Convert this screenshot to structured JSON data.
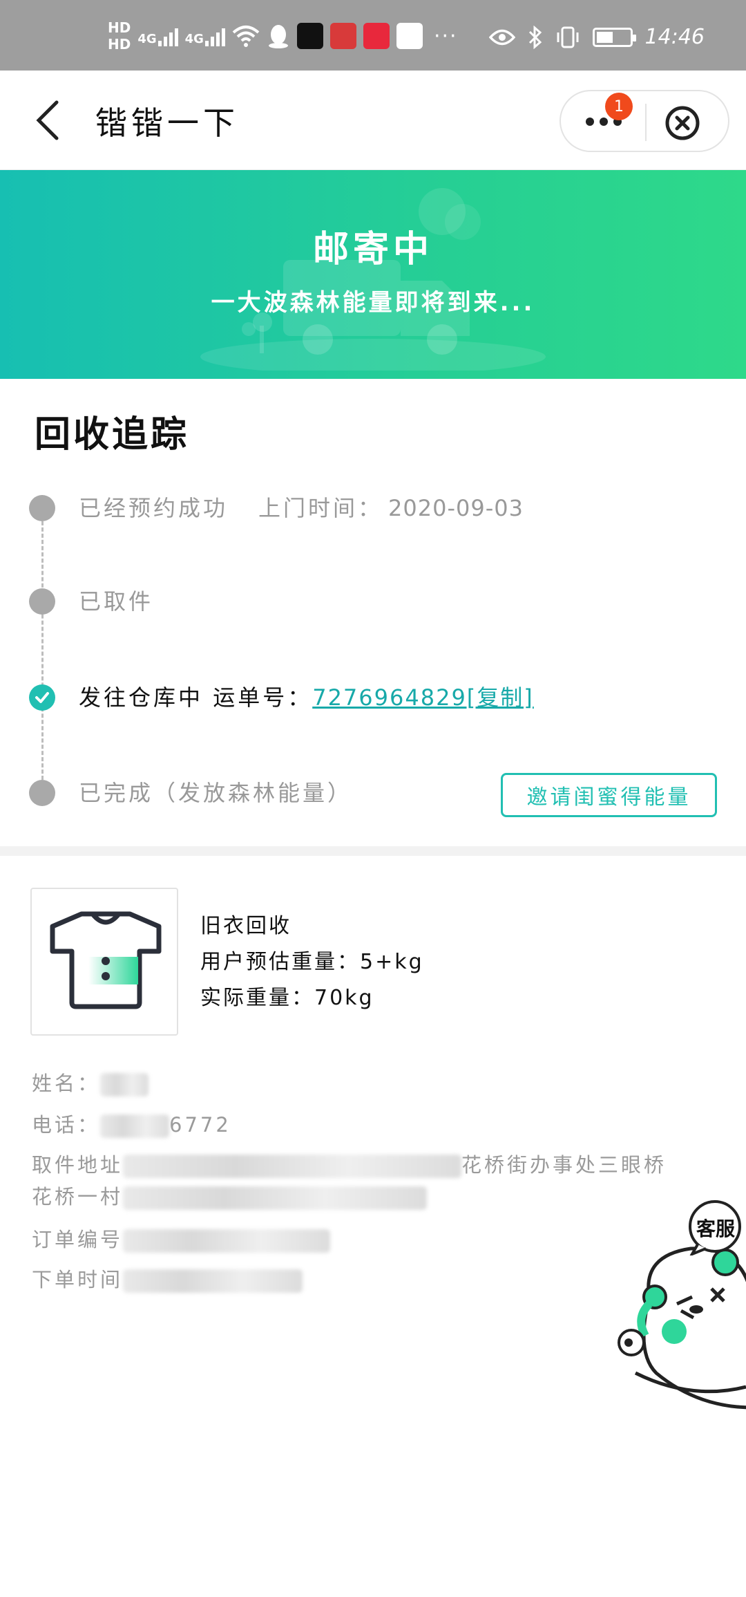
{
  "status_bar": {
    "hd1": "HD",
    "hd2": "HD",
    "net1": "4G",
    "net2": "4G",
    "more": "···",
    "time": "14:46",
    "battery_level": 0.56
  },
  "nav": {
    "title": "锴锴一下",
    "badge_count": "1"
  },
  "banner": {
    "title": "邮寄中",
    "subtitle": "一大波森林能量即将到来..."
  },
  "tracking": {
    "title": "回收追踪",
    "steps": [
      {
        "label": "已经预约成功",
        "meta_label": "上门时间：",
        "meta_value": "2020-09-03",
        "status": "done"
      },
      {
        "label": "已取件",
        "status": "done"
      },
      {
        "label": "发往仓库中",
        "waybill_label": "运单号：",
        "waybill_link": "7276964829[复制]",
        "status": "current"
      },
      {
        "label": "已完成（发放森林能量）",
        "status": "pending"
      }
    ],
    "invite_button": "邀请闺蜜得能量"
  },
  "order": {
    "item_name": "旧衣回收",
    "estimated_weight": "用户预估重量：5+kg",
    "actual_weight": "实际重量：70kg",
    "name_label": "姓名：",
    "phone_label": "电话：",
    "phone_tail": "6772",
    "address_label": "取件地址",
    "address_visible": "花桥街办事处三眼桥",
    "address_line2": "花桥一村",
    "order_no_label": "订单编号",
    "order_time_label": "下单时间"
  },
  "service": {
    "label": "客服"
  },
  "colors": {
    "accent": "#21bfb2",
    "banner_start": "#17bfb2",
    "banner_end": "#2ed98a",
    "badge": "#f04a1c",
    "status_bar": "#9e9e9e"
  }
}
